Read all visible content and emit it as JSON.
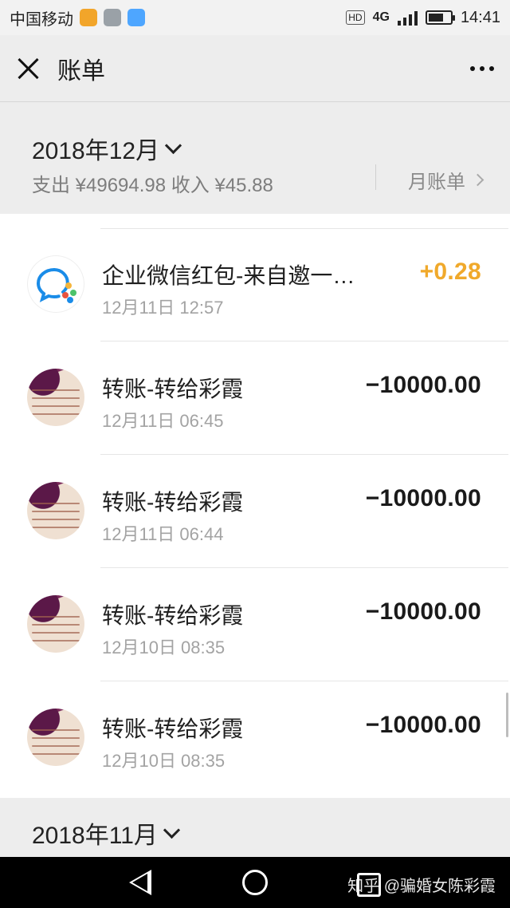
{
  "status_bar": {
    "carrier": "中国移动",
    "icons": [
      "app-icon",
      "gallery-icon",
      "wifi-icon"
    ],
    "hd": "HD",
    "network": "4G",
    "time": "14:41",
    "battery_level": 0.7
  },
  "header": {
    "title": "账单",
    "close_icon": "close-icon",
    "more_icon": "more-icon"
  },
  "current_month": {
    "label": "2018年12月",
    "summary": "支出 ¥49694.98 收入 ¥45.88",
    "monthly_bill_label": "月账单"
  },
  "transactions": [
    {
      "name": "企业微信红包-来自邀一…",
      "time": "12月11日 12:57",
      "amount": "+0.28",
      "type": "income",
      "avatar": "wecom-icon"
    },
    {
      "name": "转账-转给彩霞",
      "time": "12月11日 06:45",
      "amount": "−10000.00",
      "type": "expense",
      "avatar": "photo-avatar"
    },
    {
      "name": "转账-转给彩霞",
      "time": "12月11日 06:44",
      "amount": "−10000.00",
      "type": "expense",
      "avatar": "photo-avatar"
    },
    {
      "name": "转账-转给彩霞",
      "time": "12月10日 08:35",
      "amount": "−10000.00",
      "type": "expense",
      "avatar": "photo-avatar"
    },
    {
      "name": "转账-转给彩霞",
      "time": "12月10日 08:35",
      "amount": "−10000.00",
      "type": "expense",
      "avatar": "photo-avatar"
    }
  ],
  "next_month": {
    "label": "2018年11月"
  },
  "system_nav": {
    "watermark": "知乎 @骗婚女陈彩霞"
  },
  "colors": {
    "income": "#f0a92b",
    "background": "#ededed"
  }
}
